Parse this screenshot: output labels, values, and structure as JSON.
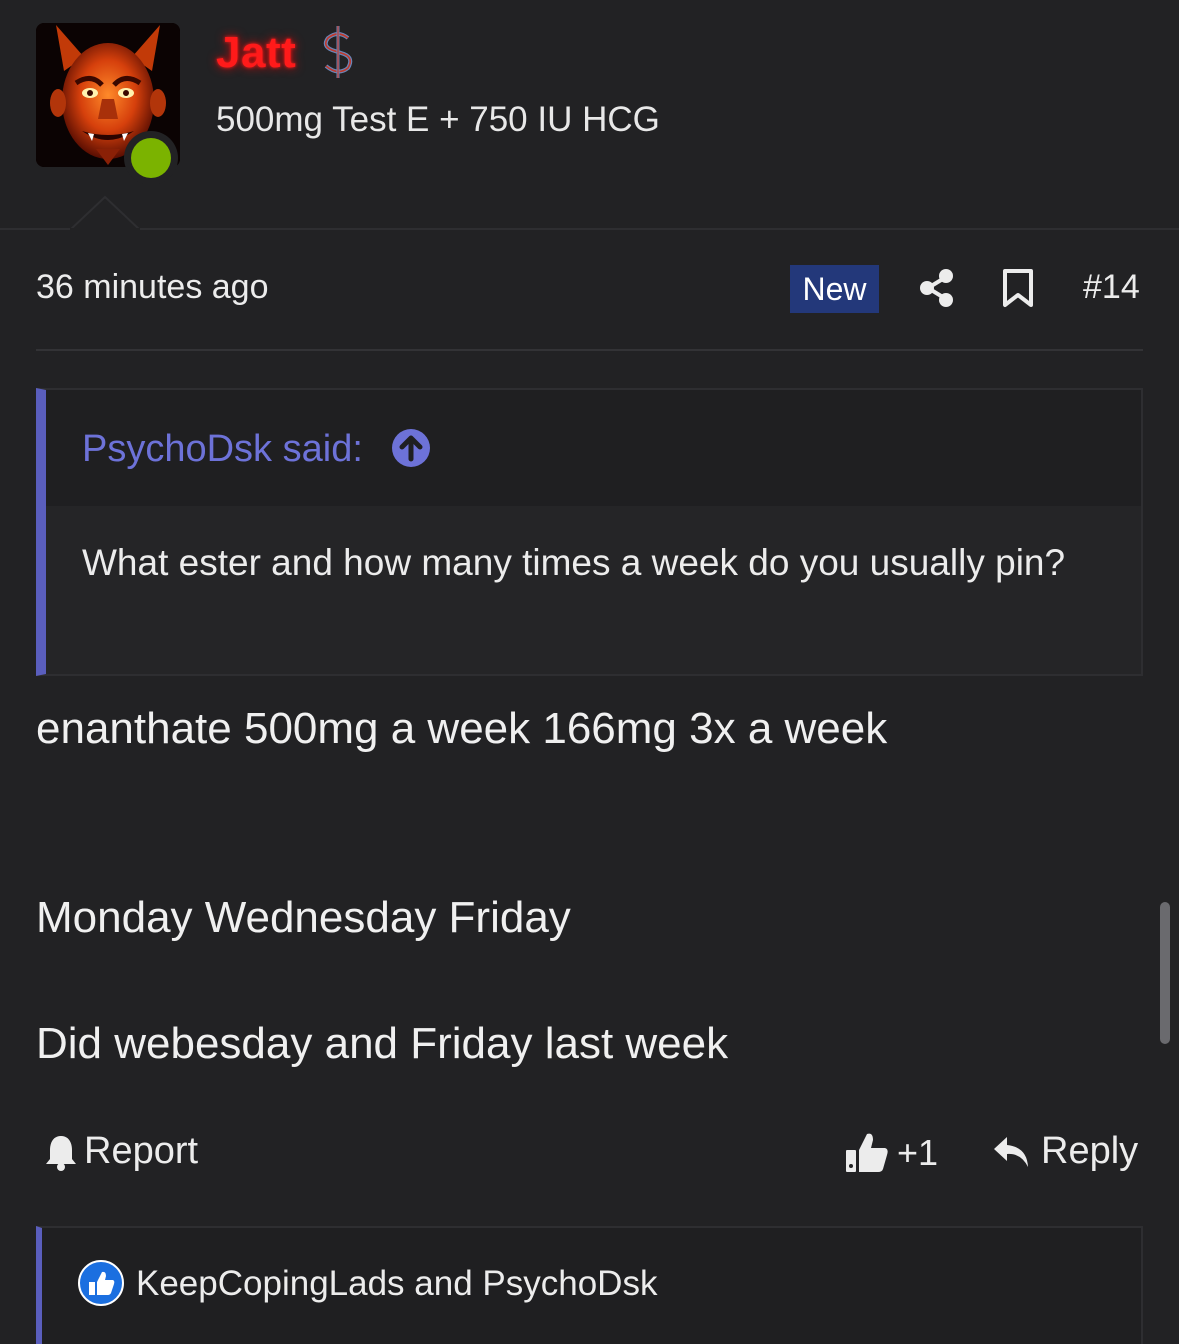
{
  "user": {
    "name": "Jatt",
    "title": "500mg Test E + 750 IU HCG",
    "online": true,
    "badge_icon": "dollar-sign-icon",
    "name_color": "#ff1a1a"
  },
  "post": {
    "time": "36 minutes ago",
    "new_label": "New",
    "number": "#14"
  },
  "quote": {
    "author_label": "PsychoDsk said:",
    "text": "What ester and how many times a week do you usually pin?"
  },
  "body": {
    "line1": "enanthate 500mg a week 166mg 3x a week",
    "line2": "Monday Wednesday Friday",
    "line3": "Did webesday and Friday last week"
  },
  "actions": {
    "report_label": "Report",
    "like_count": "+1",
    "reply_label": "Reply"
  },
  "reactions": {
    "users": "KeepCopingLads and PsychoDsk"
  },
  "colors": {
    "background": "#222224",
    "accent": "#5a5ebd",
    "new_badge": "#23387a",
    "online": "#7bb300"
  }
}
